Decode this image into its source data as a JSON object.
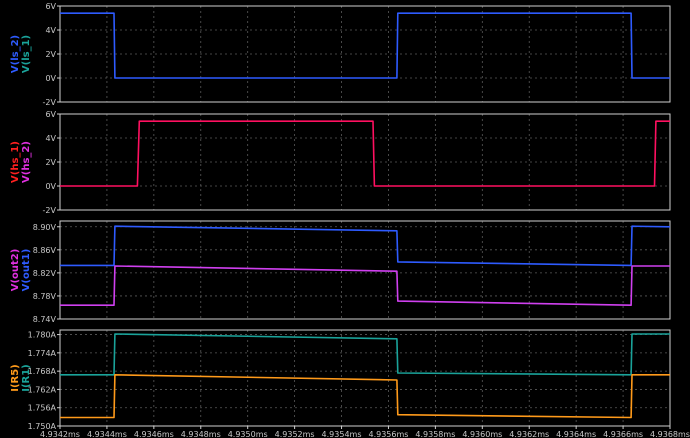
{
  "colors": {
    "background": "#000000",
    "frame": "#d0d0d0",
    "grid": "#5a5a5a",
    "tick_text": "#c8c8c8"
  },
  "chart_data": [
    {
      "type": "line",
      "ylim": [
        -2,
        6
      ],
      "yticks": [
        "-2V",
        "0V",
        "2V",
        "4V",
        "6V"
      ],
      "labels": [
        {
          "text": "V(ls_2)",
          "color": "#2e5bff"
        },
        {
          "text": "V(ls_1)",
          "color": "#1aa39a"
        }
      ],
      "series": [
        {
          "name": "V(ls_2)",
          "color": "#2e5bff",
          "x": [
            4.9342,
            4.93443,
            4.934434,
            4.935636,
            4.93564,
            4.936634,
            4.936638,
            4.9368
          ],
          "y": [
            5.4,
            5.4,
            0,
            0,
            5.4,
            5.4,
            0,
            0
          ]
        }
      ]
    },
    {
      "type": "line",
      "ylim": [
        -2,
        6
      ],
      "yticks": [
        "-2V",
        "0V",
        "2V",
        "4V",
        "6V"
      ],
      "labels": [
        {
          "text": "V(hs_1)",
          "color": "#ff2020"
        },
        {
          "text": "V(hs_2)",
          "color": "#e030e0"
        }
      ],
      "series": [
        {
          "name": "V(hs_1)",
          "color": "#ff1060",
          "x": [
            4.9342,
            4.93453,
            4.934538,
            4.935534,
            4.93554,
            4.936734,
            4.93674,
            4.9368
          ],
          "y": [
            0,
            0,
            5.4,
            5.4,
            0,
            0,
            5.4,
            5.4
          ]
        }
      ]
    },
    {
      "type": "line",
      "ylim": [
        8.74,
        8.91
      ],
      "yticks": [
        "8.74V",
        "8.78V",
        "8.82V",
        "8.86V",
        "8.90V"
      ],
      "labels": [
        {
          "text": "V(out2)",
          "color": "#e030e0"
        },
        {
          "text": "V(out1)",
          "color": "#2e5bff"
        }
      ],
      "series": [
        {
          "name": "V(out1)",
          "color": "#2e5bff",
          "x": [
            4.9342,
            4.93443,
            4.934434,
            4.935636,
            4.93564,
            4.936634,
            4.936638,
            4.9368
          ],
          "y": [
            8.833,
            8.833,
            8.901,
            8.893,
            8.839,
            8.833,
            8.901,
            8.9
          ]
        },
        {
          "name": "V(out2)",
          "color": "#d040f0",
          "x": [
            4.9342,
            4.93443,
            4.934434,
            4.935636,
            4.93564,
            4.936634,
            4.936638,
            4.9368
          ],
          "y": [
            8.764,
            8.764,
            8.832,
            8.823,
            8.771,
            8.764,
            8.832,
            8.832
          ]
        }
      ]
    },
    {
      "type": "line",
      "ylim": [
        1.75,
        1.7815
      ],
      "yticks": [
        "1.750A",
        "1.756A",
        "1.762A",
        "1.768A",
        "1.774A",
        "1.780A"
      ],
      "labels": [
        {
          "text": "I(R5)",
          "color": "#ff9a1a"
        },
        {
          "text": "I(R1)",
          "color": "#1aa39a"
        }
      ],
      "series": [
        {
          "name": "I(R1)",
          "color": "#1aa39a",
          "x": [
            4.9342,
            4.93443,
            4.934434,
            4.935636,
            4.93564,
            4.936634,
            4.936638,
            4.9368
          ],
          "y": [
            1.7668,
            1.7668,
            1.7802,
            1.7786,
            1.7674,
            1.7668,
            1.7802,
            1.7802
          ]
        },
        {
          "name": "I(R5)",
          "color": "#ff9a1a",
          "x": [
            4.9342,
            4.93443,
            4.934434,
            4.935636,
            4.93564,
            4.936634,
            4.936638,
            4.9368
          ],
          "y": [
            1.7528,
            1.7528,
            1.7668,
            1.7651,
            1.7537,
            1.7528,
            1.7668,
            1.7668
          ]
        }
      ]
    }
  ],
  "x_axis": {
    "xlim": [
      4.9342,
      4.9368
    ],
    "ticks": [
      4.9342,
      4.9344,
      4.9346,
      4.9348,
      4.935,
      4.9352,
      4.9354,
      4.9356,
      4.9358,
      4.936,
      4.9362,
      4.9364,
      4.9366,
      4.9368
    ],
    "tick_labels": [
      "4.9342ms",
      "4.9344ms",
      "4.9346ms",
      "4.9348ms",
      "4.9350ms",
      "4.9352ms",
      "4.9354ms",
      "4.9356ms",
      "4.9358ms",
      "4.9360ms",
      "4.9362ms",
      "4.9364ms",
      "4.9366ms",
      "4.9368ms"
    ]
  }
}
